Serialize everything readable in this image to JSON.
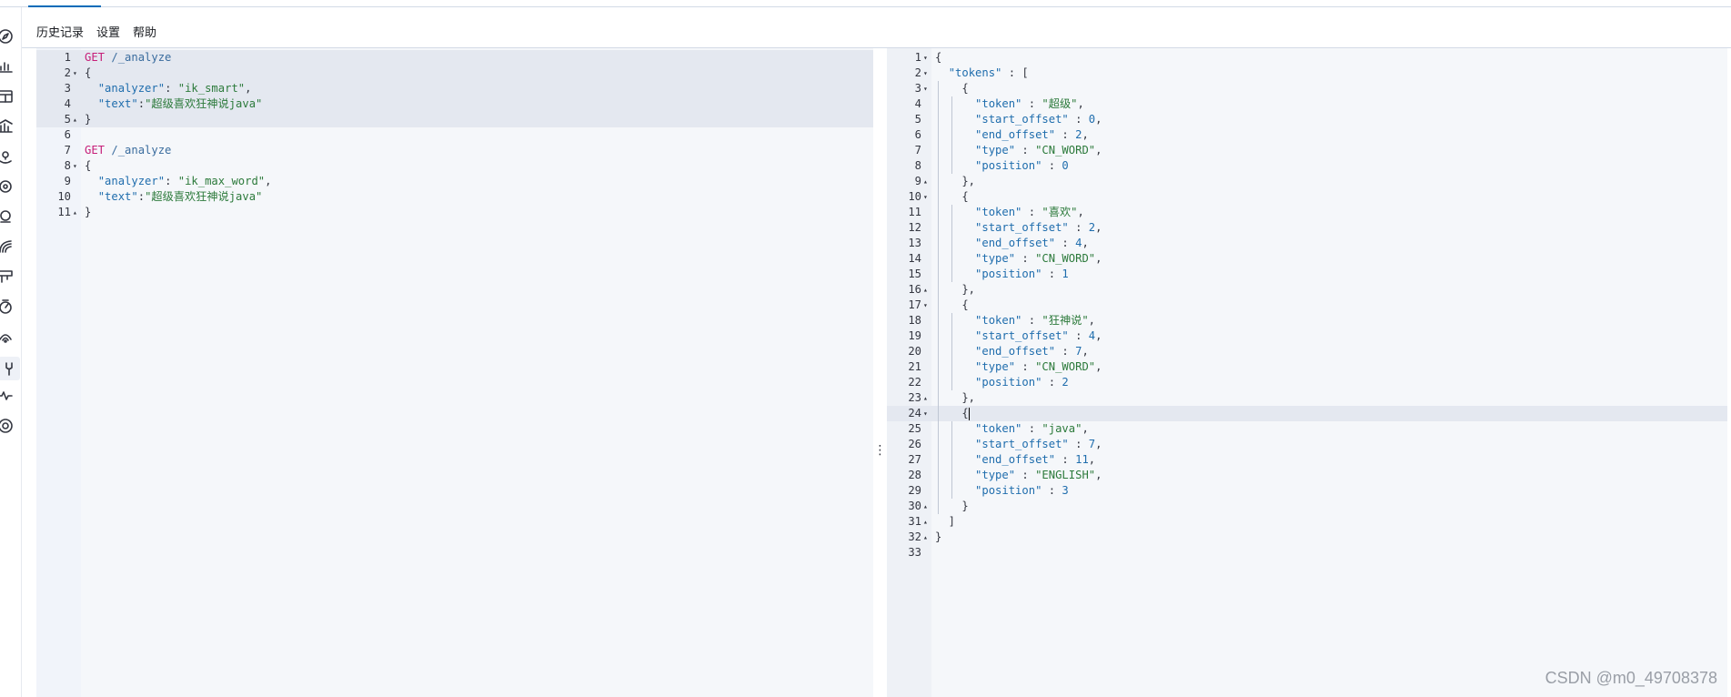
{
  "menu": {
    "history": "历史记录",
    "settings": "设置",
    "help": "帮助"
  },
  "rail_icons": [
    "compass-icon",
    "chart-icon",
    "dashboard-icon",
    "canvas-icon",
    "maps-icon",
    "ml-icon",
    "graph-icon",
    "observability-icon",
    "stack-icon",
    "uptime-icon",
    "apm-icon",
    "devtools-icon",
    "monitoring-icon",
    "management-icon"
  ],
  "request": {
    "toolbar": {
      "run": "play-icon",
      "settings": "wrench-icon"
    },
    "lines": [
      {
        "n": "1",
        "fold": "",
        "hl": true,
        "tokens": [
          [
            "m",
            "GET"
          ],
          [
            "p",
            " "
          ],
          [
            "u",
            "/_analyze"
          ]
        ]
      },
      {
        "n": "2",
        "fold": "▾",
        "hl": true,
        "tokens": [
          [
            "p",
            "{"
          ]
        ]
      },
      {
        "n": "3",
        "fold": "",
        "hl": true,
        "tokens": [
          [
            "p",
            "  "
          ],
          [
            "k",
            "\"analyzer\""
          ],
          [
            "p",
            ": "
          ],
          [
            "s",
            "\"ik_smart\""
          ],
          [
            "p",
            ","
          ]
        ]
      },
      {
        "n": "4",
        "fold": "",
        "hl": true,
        "tokens": [
          [
            "p",
            "  "
          ],
          [
            "k",
            "\"text\""
          ],
          [
            "p",
            ":"
          ],
          [
            "s",
            "\"超级喜欢狂神说java\""
          ]
        ]
      },
      {
        "n": "5",
        "fold": "▴",
        "hl": true,
        "tokens": [
          [
            "p",
            "}"
          ]
        ]
      },
      {
        "n": "6",
        "fold": "",
        "hl": false,
        "tokens": []
      },
      {
        "n": "7",
        "fold": "",
        "hl": false,
        "tokens": [
          [
            "m",
            "GET"
          ],
          [
            "p",
            " "
          ],
          [
            "u",
            "/_analyze"
          ]
        ]
      },
      {
        "n": "8",
        "fold": "▾",
        "hl": false,
        "tokens": [
          [
            "p",
            "{"
          ]
        ]
      },
      {
        "n": "9",
        "fold": "",
        "hl": false,
        "tokens": [
          [
            "p",
            "  "
          ],
          [
            "k",
            "\"analyzer\""
          ],
          [
            "p",
            ": "
          ],
          [
            "s",
            "\"ik_max_word\""
          ],
          [
            "p",
            ","
          ]
        ]
      },
      {
        "n": "10",
        "fold": "",
        "hl": false,
        "tokens": [
          [
            "p",
            "  "
          ],
          [
            "k",
            "\"text\""
          ],
          [
            "p",
            ":"
          ],
          [
            "s",
            "\"超级喜欢狂神说java\""
          ]
        ]
      },
      {
        "n": "11",
        "fold": "▴",
        "hl": false,
        "tokens": [
          [
            "p",
            "}"
          ]
        ]
      }
    ]
  },
  "response": {
    "lines": [
      {
        "n": "1",
        "fold": "▾",
        "tokens": [
          [
            "p",
            "{"
          ]
        ]
      },
      {
        "n": "2",
        "fold": "▾",
        "tokens": [
          [
            "p",
            "  "
          ],
          [
            "k",
            "\"tokens\""
          ],
          [
            "p",
            " : ["
          ]
        ]
      },
      {
        "n": "3",
        "fold": "▾",
        "tokens": [
          [
            "p",
            "    {"
          ]
        ]
      },
      {
        "n": "4",
        "fold": "",
        "tokens": [
          [
            "p",
            "      "
          ],
          [
            "k",
            "\"token\""
          ],
          [
            "p",
            " : "
          ],
          [
            "s",
            "\"超级\""
          ],
          [
            "p",
            ","
          ]
        ]
      },
      {
        "n": "5",
        "fold": "",
        "tokens": [
          [
            "p",
            "      "
          ],
          [
            "k",
            "\"start_offset\""
          ],
          [
            "p",
            " : "
          ],
          [
            "n",
            "0"
          ],
          [
            "p",
            ","
          ]
        ]
      },
      {
        "n": "6",
        "fold": "",
        "tokens": [
          [
            "p",
            "      "
          ],
          [
            "k",
            "\"end_offset\""
          ],
          [
            "p",
            " : "
          ],
          [
            "n",
            "2"
          ],
          [
            "p",
            ","
          ]
        ]
      },
      {
        "n": "7",
        "fold": "",
        "tokens": [
          [
            "p",
            "      "
          ],
          [
            "k",
            "\"type\""
          ],
          [
            "p",
            " : "
          ],
          [
            "s",
            "\"CN_WORD\""
          ],
          [
            "p",
            ","
          ]
        ]
      },
      {
        "n": "8",
        "fold": "",
        "tokens": [
          [
            "p",
            "      "
          ],
          [
            "k",
            "\"position\""
          ],
          [
            "p",
            " : "
          ],
          [
            "n",
            "0"
          ]
        ]
      },
      {
        "n": "9",
        "fold": "▴",
        "tokens": [
          [
            "p",
            "    },"
          ]
        ]
      },
      {
        "n": "10",
        "fold": "▾",
        "tokens": [
          [
            "p",
            "    {"
          ]
        ]
      },
      {
        "n": "11",
        "fold": "",
        "tokens": [
          [
            "p",
            "      "
          ],
          [
            "k",
            "\"token\""
          ],
          [
            "p",
            " : "
          ],
          [
            "s",
            "\"喜欢\""
          ],
          [
            "p",
            ","
          ]
        ]
      },
      {
        "n": "12",
        "fold": "",
        "tokens": [
          [
            "p",
            "      "
          ],
          [
            "k",
            "\"start_offset\""
          ],
          [
            "p",
            " : "
          ],
          [
            "n",
            "2"
          ],
          [
            "p",
            ","
          ]
        ]
      },
      {
        "n": "13",
        "fold": "",
        "tokens": [
          [
            "p",
            "      "
          ],
          [
            "k",
            "\"end_offset\""
          ],
          [
            "p",
            " : "
          ],
          [
            "n",
            "4"
          ],
          [
            "p",
            ","
          ]
        ]
      },
      {
        "n": "14",
        "fold": "",
        "tokens": [
          [
            "p",
            "      "
          ],
          [
            "k",
            "\"type\""
          ],
          [
            "p",
            " : "
          ],
          [
            "s",
            "\"CN_WORD\""
          ],
          [
            "p",
            ","
          ]
        ]
      },
      {
        "n": "15",
        "fold": "",
        "tokens": [
          [
            "p",
            "      "
          ],
          [
            "k",
            "\"position\""
          ],
          [
            "p",
            " : "
          ],
          [
            "n",
            "1"
          ]
        ]
      },
      {
        "n": "16",
        "fold": "▴",
        "tokens": [
          [
            "p",
            "    },"
          ]
        ]
      },
      {
        "n": "17",
        "fold": "▾",
        "tokens": [
          [
            "p",
            "    {"
          ]
        ]
      },
      {
        "n": "18",
        "fold": "",
        "tokens": [
          [
            "p",
            "      "
          ],
          [
            "k",
            "\"token\""
          ],
          [
            "p",
            " : "
          ],
          [
            "s",
            "\"狂神说\""
          ],
          [
            "p",
            ","
          ]
        ]
      },
      {
        "n": "19",
        "fold": "",
        "tokens": [
          [
            "p",
            "      "
          ],
          [
            "k",
            "\"start_offset\""
          ],
          [
            "p",
            " : "
          ],
          [
            "n",
            "4"
          ],
          [
            "p",
            ","
          ]
        ]
      },
      {
        "n": "20",
        "fold": "",
        "tokens": [
          [
            "p",
            "      "
          ],
          [
            "k",
            "\"end_offset\""
          ],
          [
            "p",
            " : "
          ],
          [
            "n",
            "7"
          ],
          [
            "p",
            ","
          ]
        ]
      },
      {
        "n": "21",
        "fold": "",
        "tokens": [
          [
            "p",
            "      "
          ],
          [
            "k",
            "\"type\""
          ],
          [
            "p",
            " : "
          ],
          [
            "s",
            "\"CN_WORD\""
          ],
          [
            "p",
            ","
          ]
        ]
      },
      {
        "n": "22",
        "fold": "",
        "tokens": [
          [
            "p",
            "      "
          ],
          [
            "k",
            "\"position\""
          ],
          [
            "p",
            " : "
          ],
          [
            "n",
            "2"
          ]
        ]
      },
      {
        "n": "23",
        "fold": "▴",
        "tokens": [
          [
            "p",
            "    },"
          ]
        ]
      },
      {
        "n": "24",
        "fold": "▾",
        "hl": true,
        "tokens": [
          [
            "p",
            "    {"
          ],
          [
            "c",
            ""
          ]
        ]
      },
      {
        "n": "25",
        "fold": "",
        "tokens": [
          [
            "p",
            "      "
          ],
          [
            "k",
            "\"token\""
          ],
          [
            "p",
            " : "
          ],
          [
            "s",
            "\"java\""
          ],
          [
            "p",
            ","
          ]
        ]
      },
      {
        "n": "26",
        "fold": "",
        "tokens": [
          [
            "p",
            "      "
          ],
          [
            "k",
            "\"start_offset\""
          ],
          [
            "p",
            " : "
          ],
          [
            "n",
            "7"
          ],
          [
            "p",
            ","
          ]
        ]
      },
      {
        "n": "27",
        "fold": "",
        "tokens": [
          [
            "p",
            "      "
          ],
          [
            "k",
            "\"end_offset\""
          ],
          [
            "p",
            " : "
          ],
          [
            "n",
            "11"
          ],
          [
            "p",
            ","
          ]
        ]
      },
      {
        "n": "28",
        "fold": "",
        "tokens": [
          [
            "p",
            "      "
          ],
          [
            "k",
            "\"type\""
          ],
          [
            "p",
            " : "
          ],
          [
            "s",
            "\"ENGLISH\""
          ],
          [
            "p",
            ","
          ]
        ]
      },
      {
        "n": "29",
        "fold": "",
        "tokens": [
          [
            "p",
            "      "
          ],
          [
            "k",
            "\"position\""
          ],
          [
            "p",
            " : "
          ],
          [
            "n",
            "3"
          ]
        ]
      },
      {
        "n": "30",
        "fold": "▴",
        "tokens": [
          [
            "p",
            "    }"
          ]
        ]
      },
      {
        "n": "31",
        "fold": "▴",
        "tokens": [
          [
            "p",
            "  ]"
          ]
        ]
      },
      {
        "n": "32",
        "fold": "▴",
        "tokens": [
          [
            "p",
            "}"
          ]
        ]
      },
      {
        "n": "33",
        "fold": "",
        "tokens": []
      }
    ]
  },
  "splitter_glyph": "⋮",
  "watermark": "CSDN @m0_49708378"
}
